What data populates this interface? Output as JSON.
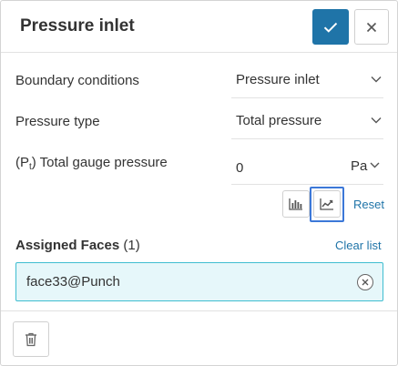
{
  "header": {
    "title": "Pressure inlet"
  },
  "boundary_conditions": {
    "label": "Boundary conditions",
    "value": "Pressure inlet"
  },
  "pressure_type": {
    "label": "Pressure type",
    "value": "Total pressure"
  },
  "gauge_pressure": {
    "label_prefix": "(P",
    "label_sub": "t",
    "label_suffix": ") Total gauge pressure",
    "value": "0",
    "unit": "Pa"
  },
  "tools": {
    "reset_label": "Reset"
  },
  "assigned_faces": {
    "label": "Assigned Faces",
    "count": "(1)",
    "clear_label": "Clear list",
    "items": [
      "face33@Punch"
    ]
  },
  "colors": {
    "accent": "#1f74a8",
    "highlight": "#3c78d8",
    "chip_bg": "#e6f7fa",
    "chip_border": "#3fbdd0"
  }
}
